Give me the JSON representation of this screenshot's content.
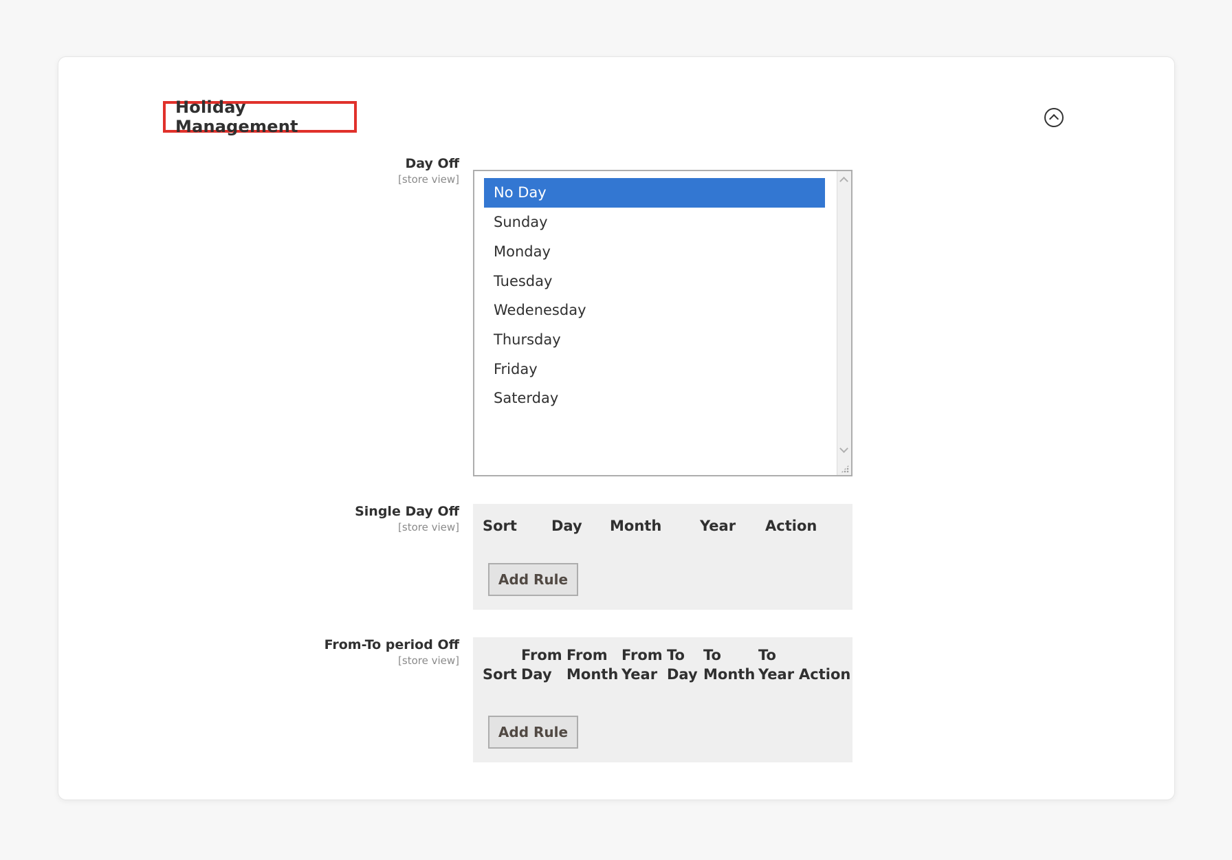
{
  "section": {
    "title": "Holiday Management",
    "collapse_icon": "chevron-up-circle-icon"
  },
  "day_off": {
    "label": "Day Off",
    "scope": "[store view]",
    "options": [
      "No Day",
      "Sunday",
      "Monday",
      "Tuesday",
      "Wedenesday",
      "Thursday",
      "Friday",
      "Saterday"
    ],
    "selected": "No Day"
  },
  "single_day_off": {
    "label": "Single Day Off",
    "scope": "[store view]",
    "columns": [
      "Sort",
      "Day",
      "Month",
      "Year",
      "Action"
    ],
    "add_button": "Add Rule"
  },
  "period_off": {
    "label": "From-To period Off",
    "scope": "[store view]",
    "columns": [
      {
        "line1": "",
        "line2": "Sort"
      },
      {
        "line1": "From",
        "line2": "Day"
      },
      {
        "line1": "From",
        "line2": "Month"
      },
      {
        "line1": "From",
        "line2": "Year"
      },
      {
        "line1": "To",
        "line2": "Day"
      },
      {
        "line1": "To",
        "line2": "Month"
      },
      {
        "line1": "To",
        "line2": "Year"
      },
      {
        "line1": "",
        "line2": "Action"
      }
    ],
    "add_button": "Add Rule"
  },
  "colors": {
    "selected_option": "#3377d2",
    "highlight_border": "#e0312b",
    "grid_background": "#efefef"
  }
}
